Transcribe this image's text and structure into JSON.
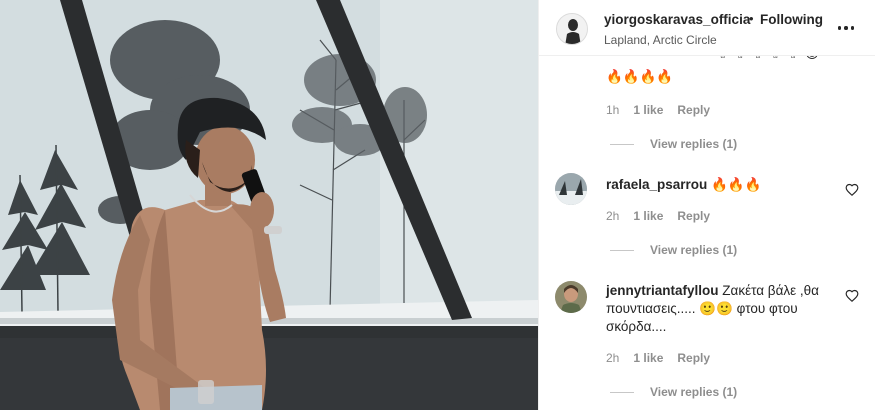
{
  "header": {
    "username": "yiorgoskaravas_officia",
    "separator": "•",
    "follow_label": "Following",
    "location": "Lapland, Arctic Circle"
  },
  "comments": [
    {
      "username": "",
      "text": "🔥🔥🔥🔥",
      "time": "1h",
      "likes": "1 like",
      "reply_label": "Reply",
      "view_replies": "View replies (1)"
    },
    {
      "username": "rafaela_psarrou",
      "text": "🔥🔥🔥",
      "time": "2h",
      "likes": "1 like",
      "reply_label": "Reply",
      "view_replies": "View replies (1)"
    },
    {
      "username": "jennytriantafyllou",
      "text_part1": "Ζακέτα βάλε ,θα πουντιασεις..... ",
      "emoji": "🙂🙂",
      "text_part2": " φτου φτου σκόρδα....",
      "time": "2h",
      "likes": "1 like",
      "reply_label": "Reply",
      "view_replies": "View replies (1)"
    }
  ],
  "colors": {
    "text": "#262626",
    "muted": "#8e8e8e",
    "border": "#efefef"
  }
}
